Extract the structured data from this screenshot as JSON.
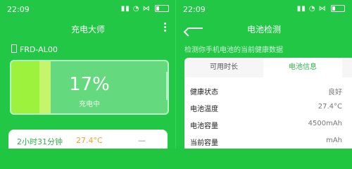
{
  "left": {
    "status": {
      "time": "22:09",
      "icons": "▮▮ ◔ ⋈"
    },
    "title": "充电大师",
    "device": "FRD-AL00",
    "battery": {
      "percent": "17%",
      "state": "充电中",
      "level": 0.17
    },
    "card": {
      "duration": "2小时31分钟",
      "temp": "27.4°C",
      "extra": "—"
    }
  },
  "right": {
    "status": {
      "time": "22:09",
      "icons": "▮▮ ◔ ⋈"
    },
    "title": "电池检测",
    "description": "检测你手机电池的当前健康数据",
    "tabs": [
      {
        "label": "可用时长"
      },
      {
        "label": "电池信息"
      }
    ],
    "rows": [
      {
        "key": "健康状态",
        "value": "良好"
      },
      {
        "key": "电池温度",
        "value": "27.4°C"
      },
      {
        "key": "电池容量",
        "value": "4500mAh"
      },
      {
        "key": "当前容量",
        "value": "mAh"
      }
    ]
  },
  "colors": {
    "primary_green": "#22c845",
    "accent_green": "#32b24e",
    "temp_orange": "#f0a12b"
  }
}
